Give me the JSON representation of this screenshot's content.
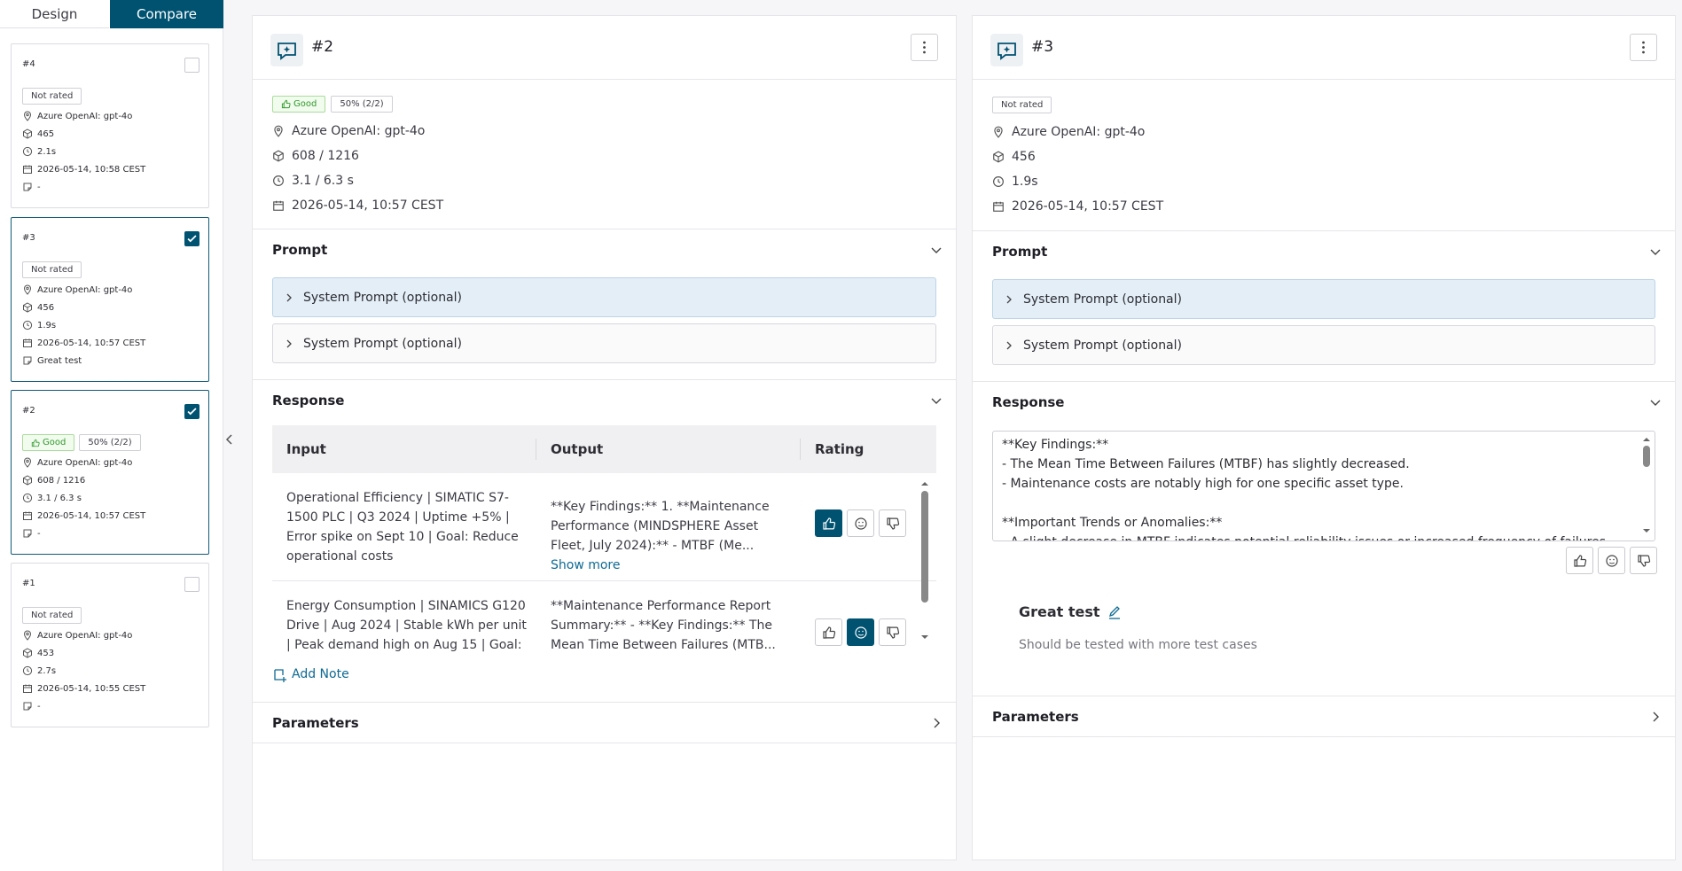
{
  "tabs": {
    "design": "Design",
    "compare": "Compare"
  },
  "runs": [
    {
      "title": "#4",
      "checked": false,
      "selected": false,
      "badges": [
        "Not rated"
      ],
      "model": "Azure OpenAI: gpt-4o",
      "tokens": "465",
      "time": "2.1s",
      "date": "2026-05-14, 10:58 CEST",
      "note": "-"
    },
    {
      "title": "#3",
      "checked": true,
      "selected": true,
      "badges": [
        "Not rated"
      ],
      "model": "Azure OpenAI: gpt-4o",
      "tokens": "456",
      "time": "1.9s",
      "date": "2026-05-14, 10:57 CEST",
      "note": "Great test"
    },
    {
      "title": "#2",
      "checked": true,
      "selected": true,
      "good": "Good",
      "percent": "50% (2/2)",
      "model": "Azure OpenAI: gpt-4o",
      "tokens": "608 / 1216",
      "time": "3.1 / 6.3 s",
      "date": "2026-05-14, 10:57 CEST",
      "note": "-"
    },
    {
      "title": "#1",
      "checked": false,
      "selected": false,
      "badges": [
        "Not rated"
      ],
      "model": "Azure OpenAI: gpt-4o",
      "tokens": "453",
      "time": "2.7s",
      "date": "2026-05-14, 10:55 CEST",
      "note": "-"
    }
  ],
  "left_panel": {
    "title": "#2",
    "good": "Good",
    "percent": "50% (2/2)",
    "model": "Azure OpenAI: gpt-4o",
    "tokens": "608 / 1216",
    "time": "3.1 / 6.3 s",
    "date": "2026-05-14, 10:57 CEST",
    "prompt_label": "Prompt",
    "system_prompt_1": "System Prompt (optional)",
    "system_prompt_2": "System Prompt (optional)",
    "response_label": "Response",
    "table": {
      "headers": [
        "Input",
        "Output",
        "Rating"
      ],
      "rows": [
        {
          "input": "Operational Efficiency | SIMATIC S7-1500 PLC | Q3 2024 | Uptime +5% | Error spike on Sept 10 | Goal: Reduce operational costs",
          "output": "**Key Findings:** 1. **Maintenance Performance (MINDSPHERE Asset Fleet, July 2024):** - MTBF (Me...",
          "show_more": "Show more",
          "rating": "up"
        },
        {
          "input": "Energy Consumption | SINAMICS G120 Drive | Aug 2024 | Stable kWh per unit | Peak demand high on Aug 15 | Goal:",
          "output": "**Maintenance Performance Report Summary:** - **Key Findings:** The Mean Time Between Failures (MTB...",
          "rating": "neutral"
        }
      ]
    },
    "add_note": "Add Note",
    "parameters_label": "Parameters"
  },
  "right_panel": {
    "title": "#3",
    "badge": "Not rated",
    "model": "Azure OpenAI: gpt-4o",
    "tokens": "456",
    "time": "1.9s",
    "date": "2026-05-14, 10:57 CEST",
    "prompt_label": "Prompt",
    "system_prompt_1": "System Prompt (optional)",
    "system_prompt_2": "System Prompt (optional)",
    "response_label": "Response",
    "response_lines": [
      "**Key Findings:**",
      "- The Mean Time Between Failures (MTBF) has slightly decreased.",
      "- Maintenance costs are notably high for one specific asset type.",
      "",
      "**Important Trends or Anomalies:**",
      "- A slight decrease in MTBF indicates potential reliability issues or increased frequency of failures."
    ],
    "note_title": "Great test",
    "note_text": "Should be tested with more test cases",
    "parameters_label": "Parameters"
  },
  "colors": {
    "accent": "#005271",
    "good": "#2e9a2a",
    "highlight": "#e3eef7"
  }
}
